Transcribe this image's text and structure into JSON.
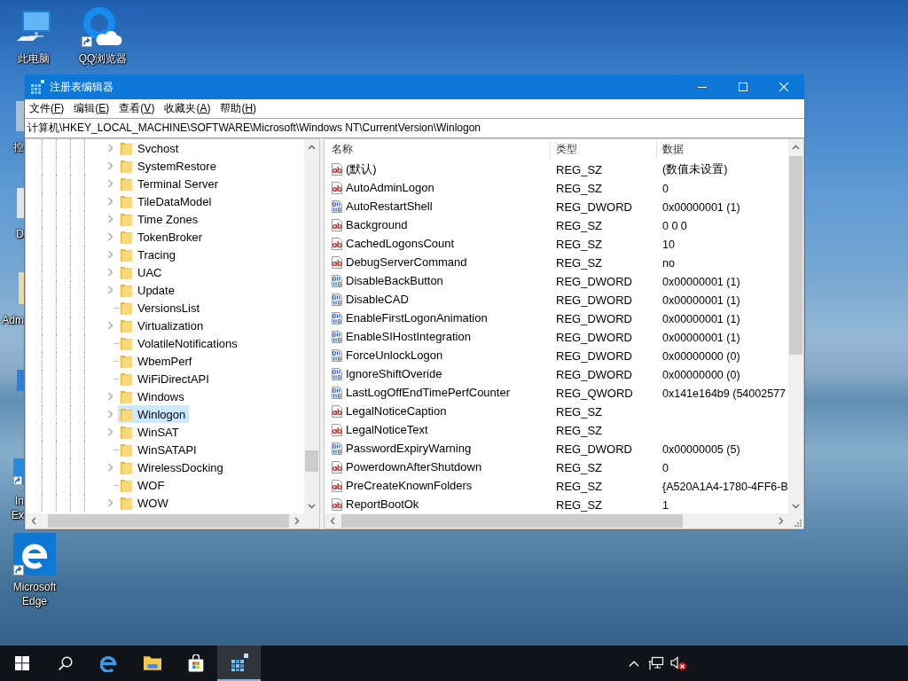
{
  "desktop": {
    "icons": [
      {
        "label": "此电脑",
        "kind": "computer",
        "shortcut": false
      },
      {
        "label": "QQ浏览器",
        "kind": "browser",
        "shortcut": true
      },
      {
        "label": "Microsoft Edge",
        "kind": "edge",
        "shortcut": true
      }
    ],
    "covered_icons": [
      {
        "label": "控",
        "kind": "panel",
        "shortcut": false
      },
      {
        "label": "D",
        "kind": "drive",
        "shortcut": false
      },
      {
        "label": "Adm",
        "kind": "user",
        "shortcut": false
      },
      {
        "kind": "network",
        "shortcut": false
      },
      {
        "label": "In Ex",
        "kind": "ie",
        "shortcut": true
      }
    ]
  },
  "window": {
    "title": "注册表编辑器",
    "menu": [
      {
        "before": "文件(",
        "key": "F",
        "after": ")"
      },
      {
        "before": "编辑(",
        "key": "E",
        "after": ")"
      },
      {
        "before": "查看(",
        "key": "V",
        "after": ")"
      },
      {
        "before": "收藏夹(",
        "key": "A",
        "after": ")"
      },
      {
        "before": "帮助(",
        "key": "H",
        "after": ")"
      }
    ],
    "address": "计算机\\HKEY_LOCAL_MACHINE\\SOFTWARE\\Microsoft\\Windows NT\\CurrentVersion\\Winlogon",
    "tree": {
      "items": [
        {
          "label": "Svchost",
          "expandable": true,
          "selected": false
        },
        {
          "label": "SystemRestore",
          "expandable": true,
          "selected": false
        },
        {
          "label": "Terminal Server",
          "expandable": true,
          "selected": false
        },
        {
          "label": "TileDataModel",
          "expandable": true,
          "selected": false
        },
        {
          "label": "Time Zones",
          "expandable": true,
          "selected": false
        },
        {
          "label": "TokenBroker",
          "expandable": true,
          "selected": false
        },
        {
          "label": "Tracing",
          "expandable": true,
          "selected": false
        },
        {
          "label": "UAC",
          "expandable": true,
          "selected": false
        },
        {
          "label": "Update",
          "expandable": true,
          "selected": false
        },
        {
          "label": "VersionsList",
          "expandable": false,
          "selected": false
        },
        {
          "label": "Virtualization",
          "expandable": true,
          "selected": false
        },
        {
          "label": "VolatileNotifications",
          "expandable": false,
          "selected": false
        },
        {
          "label": "WbemPerf",
          "expandable": false,
          "selected": false
        },
        {
          "label": "WiFiDirectAPI",
          "expandable": false,
          "selected": false
        },
        {
          "label": "Windows",
          "expandable": true,
          "selected": false
        },
        {
          "label": "Winlogon",
          "expandable": true,
          "selected": true
        },
        {
          "label": "WinSAT",
          "expandable": true,
          "selected": false
        },
        {
          "label": "WinSATAPI",
          "expandable": false,
          "selected": false
        },
        {
          "label": "WirelessDocking",
          "expandable": true,
          "selected": false
        },
        {
          "label": "WOF",
          "expandable": false,
          "selected": false
        },
        {
          "label": "WOW",
          "expandable": true,
          "selected": false
        }
      ]
    },
    "values": {
      "columns": [
        "名称",
        "类型",
        "数据"
      ],
      "rows": [
        {
          "name": "(默认)",
          "type": "REG_SZ",
          "data": "(数值未设置)",
          "kind": "string"
        },
        {
          "name": "AutoAdminLogon",
          "type": "REG_SZ",
          "data": "0",
          "kind": "string"
        },
        {
          "name": "AutoRestartShell",
          "type": "REG_DWORD",
          "data": "0x00000001 (1)",
          "kind": "binary"
        },
        {
          "name": "Background",
          "type": "REG_SZ",
          "data": "0 0 0",
          "kind": "string"
        },
        {
          "name": "CachedLogonsCount",
          "type": "REG_SZ",
          "data": "10",
          "kind": "string"
        },
        {
          "name": "DebugServerCommand",
          "type": "REG_SZ",
          "data": "no",
          "kind": "string"
        },
        {
          "name": "DisableBackButton",
          "type": "REG_DWORD",
          "data": "0x00000001 (1)",
          "kind": "binary"
        },
        {
          "name": "DisableCAD",
          "type": "REG_DWORD",
          "data": "0x00000001 (1)",
          "kind": "binary"
        },
        {
          "name": "EnableFirstLogonAnimation",
          "type": "REG_DWORD",
          "data": "0x00000001 (1)",
          "kind": "binary"
        },
        {
          "name": "EnableSIHostIntegration",
          "type": "REG_DWORD",
          "data": "0x00000001 (1)",
          "kind": "binary"
        },
        {
          "name": "ForceUnlockLogon",
          "type": "REG_DWORD",
          "data": "0x00000000 (0)",
          "kind": "binary"
        },
        {
          "name": "IgnoreShiftOveride",
          "type": "REG_DWORD",
          "data": "0x00000000 (0)",
          "kind": "binary"
        },
        {
          "name": "LastLogOffEndTimePerfCounter",
          "type": "REG_QWORD",
          "data": "0x141e164b9 (54002577",
          "kind": "binary"
        },
        {
          "name": "LegalNoticeCaption",
          "type": "REG_SZ",
          "kind": "string"
        },
        {
          "name": "LegalNoticeText",
          "type": "REG_SZ",
          "kind": "string"
        },
        {
          "name": "PasswordExpiryWarning",
          "type": "REG_DWORD",
          "data": "0x00000005 (5)",
          "kind": "binary"
        },
        {
          "name": "PowerdownAfterShutdown",
          "type": "REG_SZ",
          "data": "0",
          "kind": "string"
        },
        {
          "name": "PreCreateKnownFolders",
          "type": "REG_SZ",
          "data": "{A520A1A4-1780-4FF6-B",
          "kind": "string"
        },
        {
          "name": "ReportBootOk",
          "type": "REG_SZ",
          "data": "1",
          "kind": "string"
        }
      ]
    }
  },
  "taskbar": {
    "buttons": [
      {
        "kind": "start",
        "active": false
      },
      {
        "kind": "search",
        "active": false
      },
      {
        "kind": "edge",
        "active": false
      },
      {
        "kind": "explorer",
        "active": false
      },
      {
        "kind": "store",
        "active": false
      },
      {
        "kind": "regedit",
        "active": true
      }
    ],
    "tray": {
      "volume_muted": true
    }
  }
}
